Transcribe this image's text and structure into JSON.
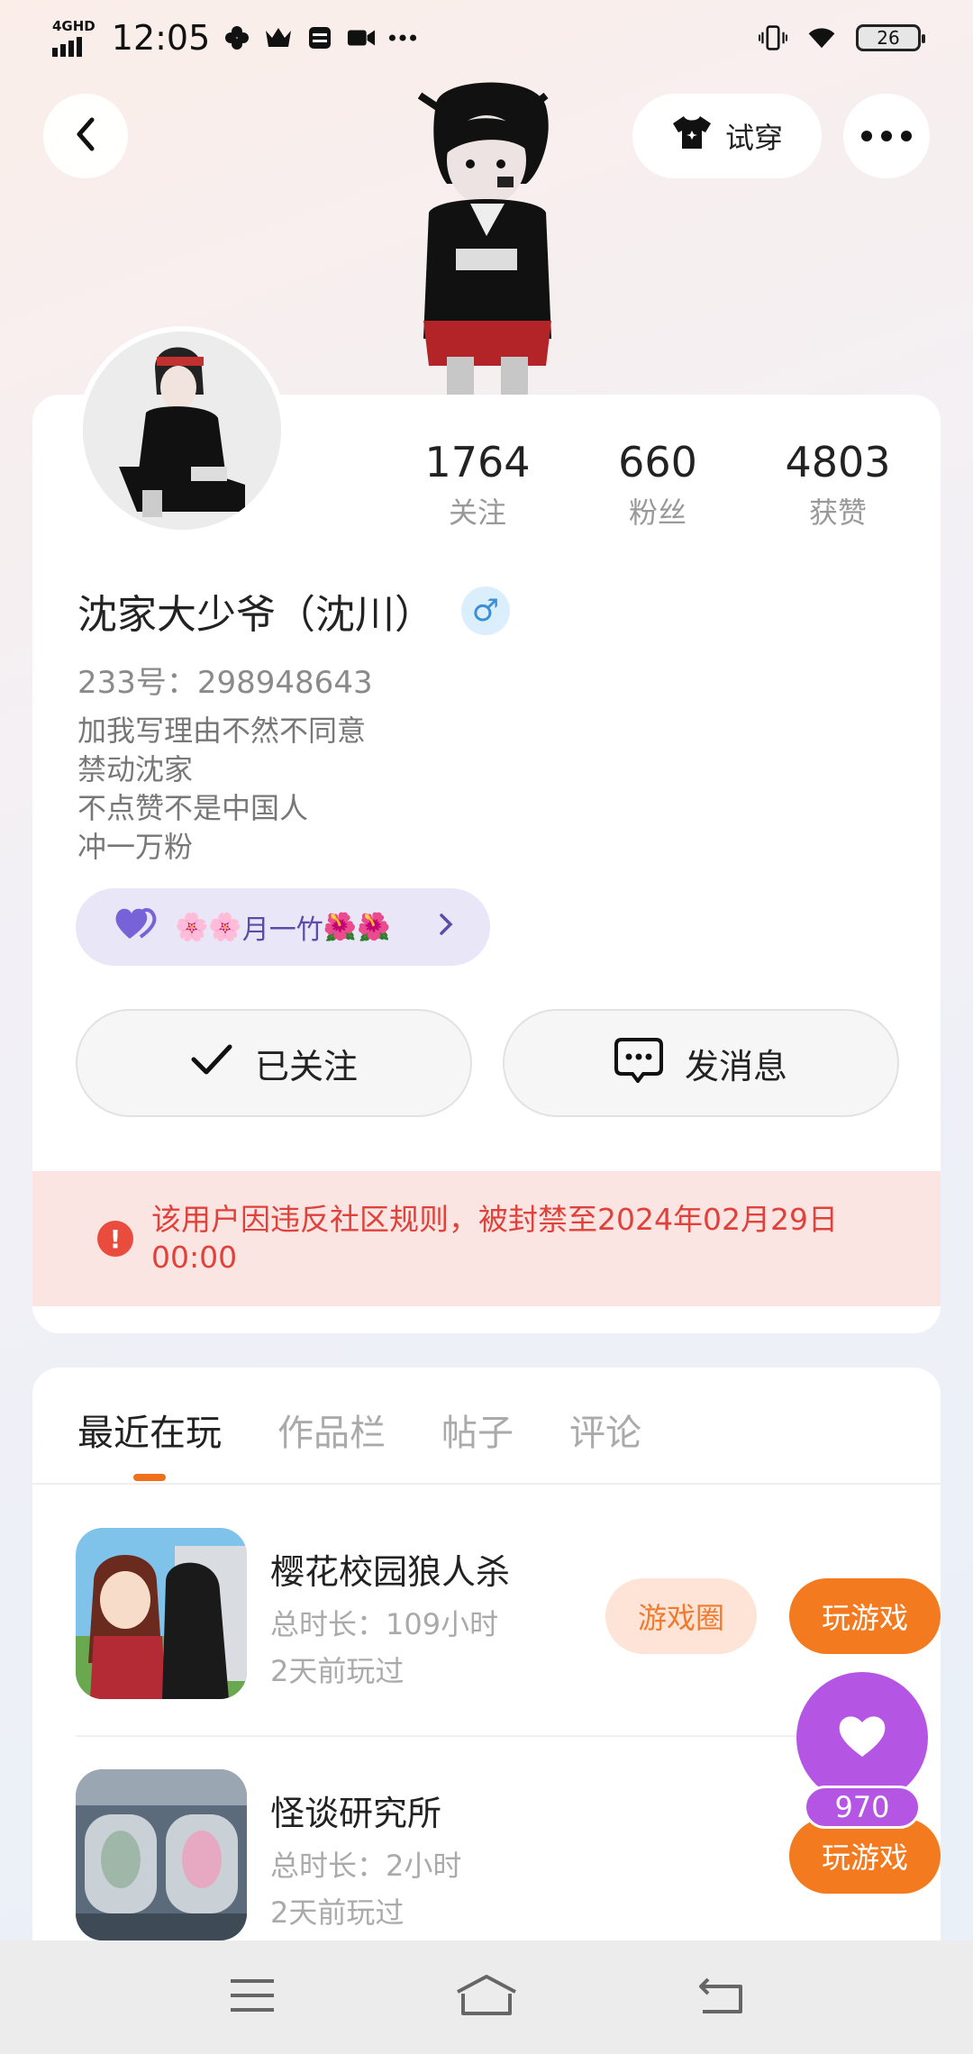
{
  "status_bar": {
    "network": "4GHD",
    "time": "12:05",
    "battery": "26"
  },
  "nav": {
    "try_on_label": "试穿"
  },
  "profile": {
    "stats": [
      {
        "value": "1764",
        "label": "关注"
      },
      {
        "value": "660",
        "label": "粉丝"
      },
      {
        "value": "4803",
        "label": "获赞"
      }
    ],
    "username": "沈家大少爷（沈川）",
    "gender_symbol": "♂",
    "uid": "233号：298948643",
    "bio": [
      "加我写理由不然不同意",
      "禁动沈家",
      "不点赞不是中国人",
      "冲一万粉"
    ],
    "tag": {
      "emoji_left": "🌸🌸",
      "text": "月一竹",
      "emoji_right": "🌺🌺",
      "heart": "💜"
    },
    "follow_label": "已关注",
    "message_label": "发消息",
    "ban_notice": "该用户因违反社区规则，被封禁至2024年02月29日 00:00"
  },
  "tabs": [
    "最近在玩",
    "作品栏",
    "帖子",
    "评论"
  ],
  "games": [
    {
      "name": "樱花校园狼人杀",
      "duration": "总时长：109小时",
      "last_played": "2天前玩过",
      "circle_label": "游戏圈",
      "play_label": "玩游戏"
    },
    {
      "name": "怪谈研究所",
      "duration": "总时长：2小时",
      "last_played": "2天前玩过",
      "play_label": "玩游戏"
    }
  ],
  "like": {
    "count": "970"
  },
  "colors": {
    "accent_orange": "#f47a1f",
    "like_purple": "#b455e4",
    "ban_red": "#e0413a"
  }
}
